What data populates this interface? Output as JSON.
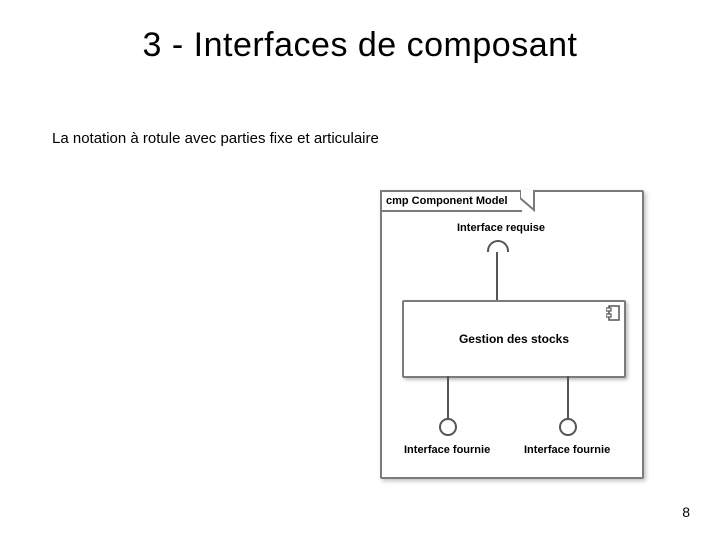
{
  "title": "3 - Interfaces de composant",
  "subtitle": "La notation à rotule avec parties fixe et articulaire",
  "page_number": "8",
  "diagram": {
    "frame_label": "cmp Component Model",
    "required_interface_label": "Interface requise",
    "component_label": "Gestion des stocks",
    "provided_interface_left_label": "Interface fournie",
    "provided_interface_right_label": "Interface fournie"
  }
}
